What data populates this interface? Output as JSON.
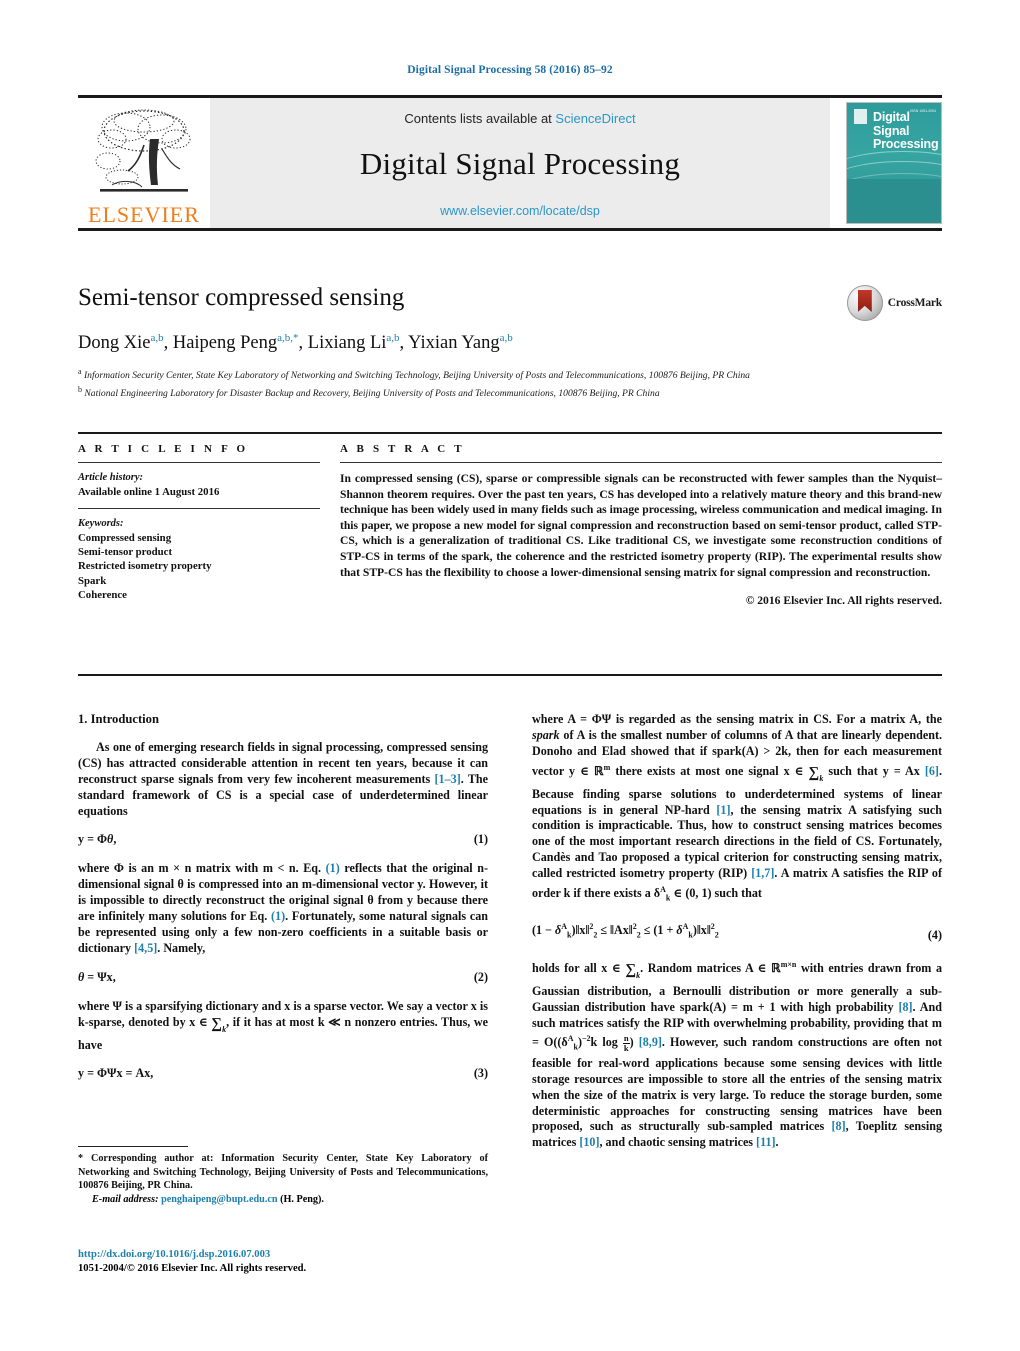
{
  "running_head": "Digital Signal Processing 58 (2016) 85–92",
  "masthead": {
    "elsevier_wordmark": "ELSEVIER",
    "contents_prefix": "Contents lists available at ",
    "sciencedirect": "ScienceDirect",
    "journal_title": "Digital Signal Processing",
    "journal_url": "www.elsevier.com/locate/dsp",
    "cover": {
      "title_line1": "Digital",
      "title_line2": "Signal",
      "title_line3": "Processing",
      "issn_tag": "ISSN 1051-2004",
      "background_color": "#2e9b9b"
    }
  },
  "article": {
    "title": "Semi-tensor compressed sensing",
    "authors": [
      {
        "name": "Dong Xie",
        "marks": "a,b",
        "sep": ", "
      },
      {
        "name": "Haipeng Peng",
        "marks": "a,b,",
        "star": "*",
        "sep": ", "
      },
      {
        "name": "Lixiang Li",
        "marks": "a,b",
        "sep": ", "
      },
      {
        "name": "Yixian Yang",
        "marks": "a,b",
        "sep": ""
      }
    ],
    "affiliations": [
      {
        "mark": "a",
        "text": "Information Security Center, State Key Laboratory of Networking and Switching Technology, Beijing University of Posts and Telecommunications, 100876 Beijing, PR China"
      },
      {
        "mark": "b",
        "text": "National Engineering Laboratory for Disaster Backup and Recovery, Beijing University of Posts and Telecommunications, 100876 Beijing, PR China"
      }
    ],
    "crossmark_label": "CrossMark"
  },
  "info": {
    "heading": "A R T I C L E  I N F O",
    "history_label": "Article history:",
    "history_value": "Available online 1 August 2016",
    "keywords_label": "Keywords:",
    "keywords": [
      "Compressed sensing",
      "Semi-tensor product",
      "Restricted isometry property",
      "Spark",
      "Coherence"
    ]
  },
  "abstract": {
    "heading": "A B S T R A C T",
    "text": "In compressed sensing (CS), sparse or compressible signals can be reconstructed with fewer samples than the Nyquist–Shannon theorem requires. Over the past ten years, CS has developed into a relatively mature theory and this brand-new technique has been widely used in many fields such as image processing, wireless communication and medical imaging. In this paper, we propose a new model for signal compression and reconstruction based on semi-tensor product, called STP-CS, which is a generalization of traditional CS. Like traditional CS, we investigate some reconstruction conditions of STP-CS in terms of the spark, the coherence and the restricted isometry property (RIP). The experimental results show that STP-CS has the flexibility to choose a lower-dimensional sensing matrix for signal compression and reconstruction.",
    "copyright": "© 2016 Elsevier Inc. All rights reserved."
  },
  "body": {
    "section1_title": "1. Introduction",
    "left": {
      "p1_a": "As one of emerging research fields in signal processing, compressed sensing (CS) has attracted considerable attention in recent ten years, because it can reconstruct sparse signals from very few incoherent measurements ",
      "p1_ref": "[1–3]",
      "p1_b": ". The standard framework of CS is a special case of underdetermined linear equations",
      "eq1_num": "(1)",
      "p2_a": "where Φ is an m × n matrix with m < n. Eq. ",
      "p2_ref1": "(1)",
      "p2_b": " reflects that the original n-dimensional signal θ is compressed into an m-dimensional vector y. However, it is impossible to directly reconstruct the original signal θ from y because there are infinitely many solutions for Eq. ",
      "p2_ref2": "(1)",
      "p2_c": ". Fortunately, some natural signals can be represented using only a few non-zero coefficients in a suitable basis or dictionary ",
      "p2_ref3": "[4,5]",
      "p2_d": ". Namely,",
      "eq2_num": "(2)",
      "p3_a": "where Ψ is a sparsifying dictionary and x is a sparse vector. We say a vector x is k-sparse, denoted by x ∈ ",
      "p3_b": ", if it has at most k ≪ n nonzero entries. Thus, we have",
      "eq3_num": "(3)"
    },
    "right": {
      "p4_a": "where A = ΦΨ is regarded as the sensing matrix in CS. For a matrix A, the ",
      "p4_spark": "spark",
      "p4_b": " of A is the smallest number of columns of A that are linearly dependent. Donoho and Elad showed that if spark(A) > 2k, then for each measurement vector y ∈ ℝ",
      "p4_c": " there exists at most one signal x ∈ ",
      "p4_d": " such that y = Ax ",
      "p4_ref1": "[6]",
      "p4_e": ". Because finding sparse solutions to underdetermined systems of linear equations is in general NP-hard ",
      "p4_ref2": "[1]",
      "p4_f": ", the sensing matrix A satisfying such condition is impracticable. Thus, how to construct sensing matrices becomes one of the most important research directions in the field of CS. Fortunately, Candès and Tao proposed a typical criterion for constructing sensing matrix, called restricted isometry property (RIP) ",
      "p4_ref3": "[1,7]",
      "p4_g": ". A matrix A satisfies the RIP of order k if there exists a δ",
      "p4_h": " ∈ (0, 1) such that",
      "eq4_num": "(4)",
      "p5_a": "holds for all x ∈ ",
      "p5_b": ". Random matrices A ∈ ℝ",
      "p5_c": " with entries drawn from a Gaussian distribution, a Bernoulli distribution or more generally a sub-Gaussian distribution have spark(A) = m + 1 with high probability ",
      "p5_ref1": "[8]",
      "p5_d": ". And such matrices satisfy the RIP with overwhelming probability, providing that m = O((δ",
      "p5_e": ")",
      "p5_f": "k log ",
      "p5_g": ") ",
      "p5_ref2": "[8,9]",
      "p5_h": ". However, such random constructions are often not feasible for real-word applications because some sensing devices with little storage resources are impossible to store all the entries of the sensing matrix when the size of the matrix is very large. To reduce the storage burden, some deterministic approaches for constructing sensing matrices have been proposed, such as structurally sub-sampled matrices ",
      "p5_ref3": "[8]",
      "p5_i": ", Toeplitz sensing matrices ",
      "p5_ref4": "[10]",
      "p5_j": ", and chaotic sensing matrices ",
      "p5_ref5": "[11]",
      "p5_k": "."
    }
  },
  "footnote": {
    "star": "*",
    "text": " Corresponding author at: Information Security Center, State Key Laboratory of Networking and Switching Technology, Beijing University of Posts and Telecommunications, 100876 Beijing, PR China.",
    "email_label": "E-mail address:",
    "email": "penghaipeng@bupt.edu.cn",
    "email_suffix": "(H. Peng)."
  },
  "doi": {
    "url": "http://dx.doi.org/10.1016/j.dsp.2016.07.003",
    "issn_line": "1051-2004/© 2016 Elsevier Inc. All rights reserved."
  },
  "colors": {
    "link": "#1c7fae",
    "sciencedirect": "#2b96c8",
    "elsevier_orange": "#ef7d1a",
    "journal_teal": "#2e9b9b",
    "running_head": "#1c6ea4"
  }
}
